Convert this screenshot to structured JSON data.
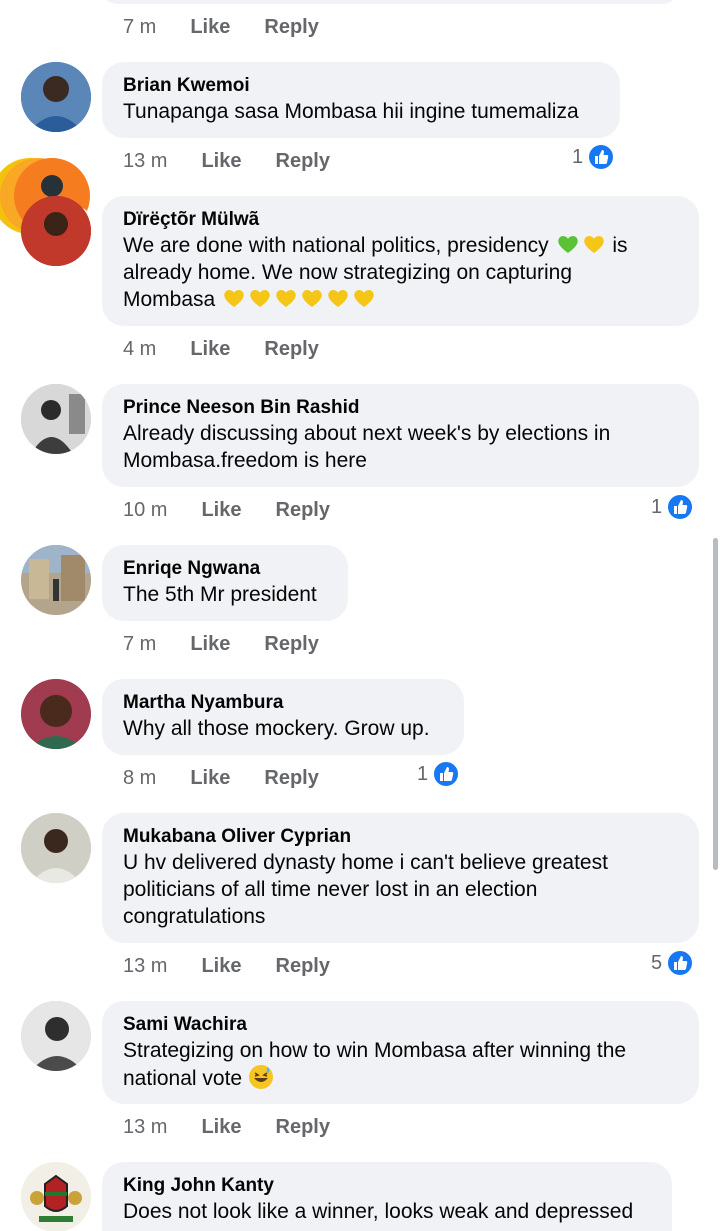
{
  "top_actions": {
    "time": "7 m",
    "like": "Like",
    "reply": "Reply"
  },
  "comments": [
    {
      "author": "Brian Kwemoi",
      "text": "Tunapanga sasa Mombasa hii ingine tumemaliza",
      "time": "13 m",
      "like": "Like",
      "reply": "Reply",
      "reactions": "1",
      "avatar_color": "#3a6ea5"
    },
    {
      "author": "Dïrëçtõr Mülwã",
      "text_parts": {
        "a": "We are done with national politics, presidency",
        "b": "is",
        "c": "already home. We now strategizing on capturing",
        "d": "Mombasa"
      },
      "time": "4 m",
      "like": "Like",
      "reply": "Reply",
      "reactions": "",
      "avatar_color": "#b03030"
    },
    {
      "author": "Prince Neeson Bin Rashid",
      "text": "Already discussing about next week's by elections in Mombasa.freedom is here",
      "time": "10 m",
      "like": "Like",
      "reply": "Reply",
      "reactions": "1",
      "avatar_color": "#6b6b6b"
    },
    {
      "author": "Enriqe Ngwana",
      "text": "The 5th Mr president",
      "time": "7 m",
      "like": "Like",
      "reply": "Reply",
      "reactions": "",
      "avatar_color": "#8a7c6a"
    },
    {
      "author": "Martha Nyambura",
      "text": "Why all those mockery. Grow up.",
      "time": "8 m",
      "like": "Like",
      "reply": "Reply",
      "reactions": "1",
      "avatar_color": "#7a3e2a"
    },
    {
      "author": "Mukabana Oliver Cyprian",
      "text": "U hv delivered dynasty home i can't believe greatest politicians of all time never lost in an election congratulations",
      "time": "13 m",
      "like": "Like",
      "reply": "Reply",
      "reactions": "5",
      "avatar_color": "#9c9a8e"
    },
    {
      "author": "Sami Wachira",
      "text": "Strategizing on how to win Mombasa after winning the national vote",
      "time": "13 m",
      "like": "Like",
      "reply": "Reply",
      "reactions": "",
      "avatar_color": "#5a5a5a"
    },
    {
      "author": "King John Kanty",
      "text": "Does not look like a winner, looks weak and depressed",
      "avatar_color": "#d9d3c2"
    }
  ],
  "colors": {
    "accent": "#1877f2",
    "bubble": "#f0f2f5",
    "meta": "#65676b",
    "heart_green": "#5bc236",
    "heart_yellow": "#f5c518",
    "chathead_orange": "#f57c1f"
  },
  "icons": {
    "like_badge": "thumbs-up-icon",
    "chathead": "messenger-chathead-icon"
  }
}
